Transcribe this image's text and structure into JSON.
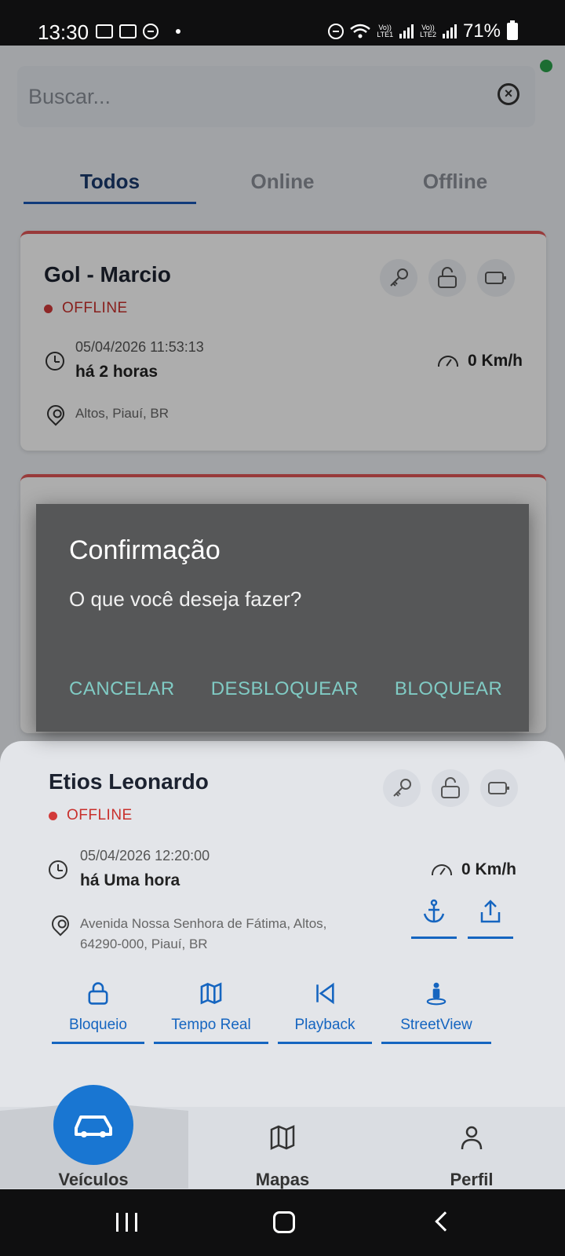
{
  "status_bar": {
    "time": "13:30",
    "battery": "71%",
    "lte1": "LTE1",
    "lte2": "LTE2",
    "vo": "Vo))"
  },
  "search": {
    "placeholder": "Buscar..."
  },
  "tabs": [
    {
      "label": "Todos"
    },
    {
      "label": "Online"
    },
    {
      "label": "Offline"
    }
  ],
  "vehicles": [
    {
      "name": "Gol - Marcio",
      "status": "OFFLINE",
      "date": "05/04/2026 11:53:13",
      "relative": "há 2 horas",
      "speed": "0 Km/h",
      "address": "Altos, Piauí, BR"
    },
    {
      "name": "Etios Leonardo",
      "status": "OFFLINE",
      "date": "05/04/2026 12:20:00",
      "relative": "há Uma hora",
      "speed": "0 Km/h",
      "address_line1": "Avenida Nossa Senhora de Fátima, Altos,",
      "address_line2": "64290-000, Piauí, BR"
    }
  ],
  "sheet_menu": [
    {
      "label": "Bloqueio"
    },
    {
      "label": "Tempo Real"
    },
    {
      "label": "Playback"
    },
    {
      "label": "StreetView"
    }
  ],
  "bottom_nav": {
    "vehicles": "Veículos",
    "maps": "Mapas",
    "profile": "Perfil"
  },
  "dialog": {
    "title": "Confirmação",
    "message": "O que você deseja fazer?",
    "cancel": "CANCELAR",
    "unlock": "DESBLOQUEAR",
    "lock": "BLOQUEAR"
  },
  "colors": {
    "accent": "#1565c0",
    "offline": "#c9302c",
    "dialog_bg": "#565758",
    "dialog_button": "#80cbc4",
    "online_dot": "#2aa14a"
  }
}
